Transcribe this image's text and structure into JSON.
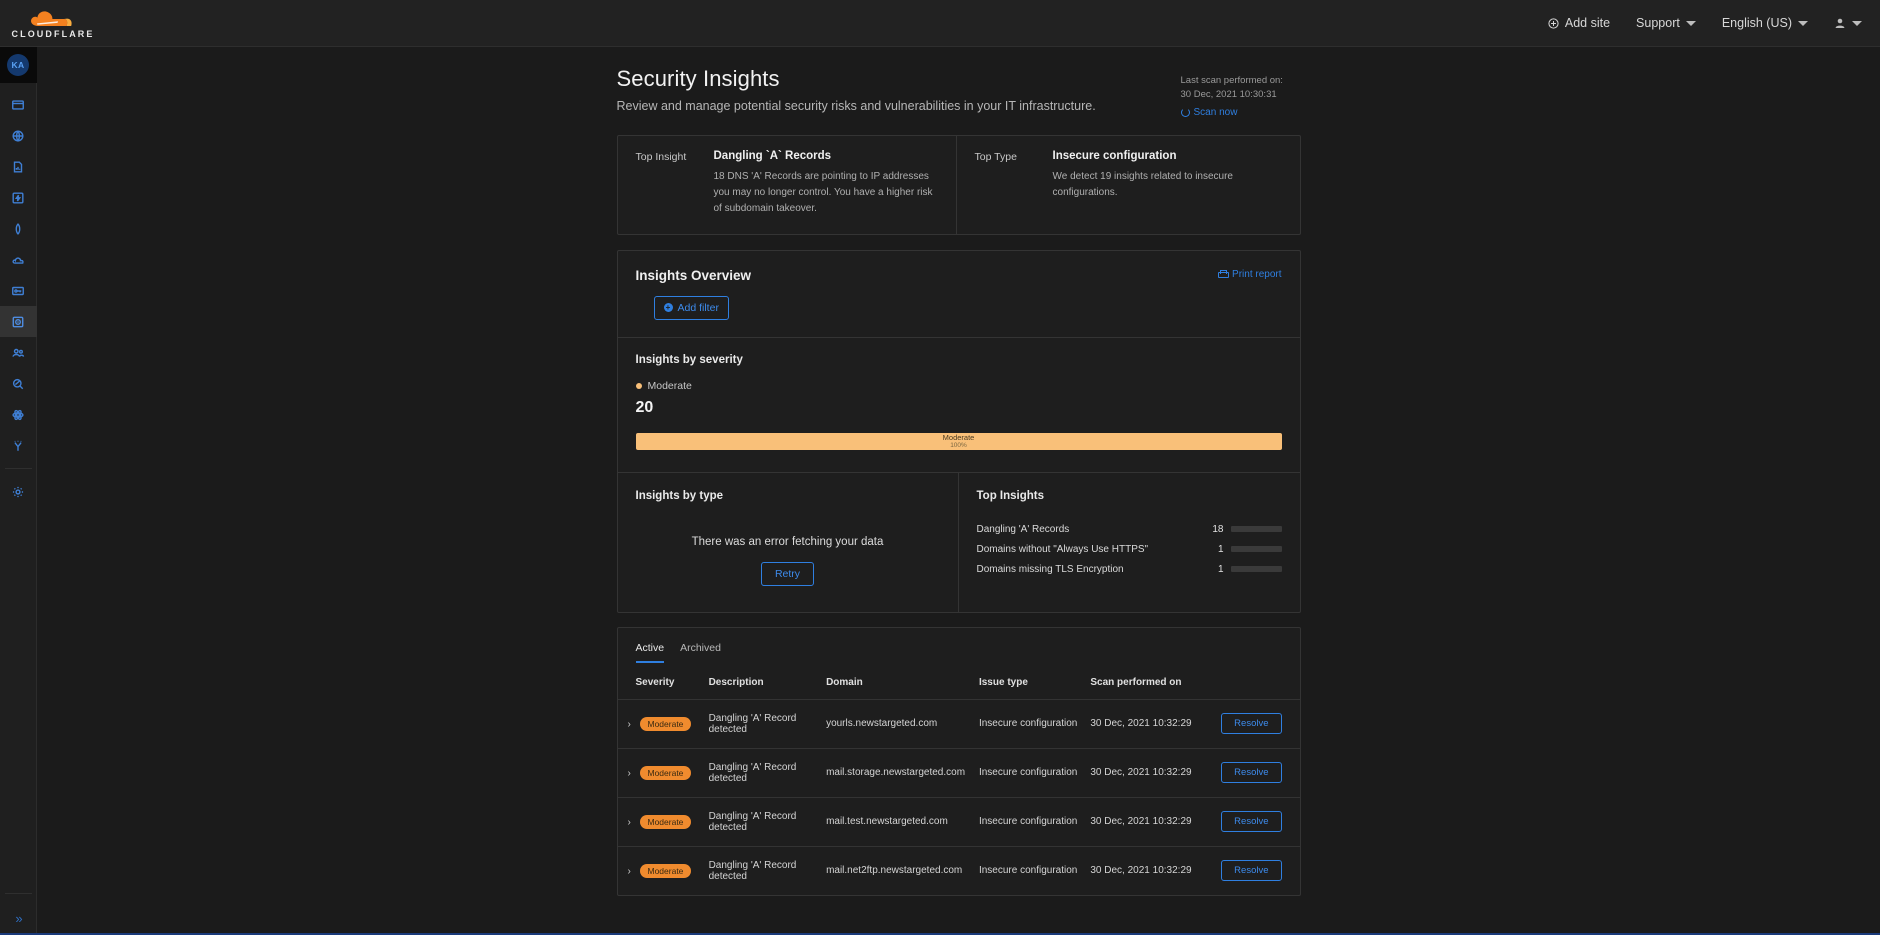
{
  "topbar": {
    "brand": "CLOUDFLARE",
    "add_site": "Add site",
    "support": "Support",
    "language": "English (US)"
  },
  "sidebar": {
    "avatar_initials": "KA",
    "expand_icon": "chevrons-right-icon",
    "items": [
      {
        "name": "sidebar-item-websites",
        "icon": "browser-window-icon"
      },
      {
        "name": "sidebar-item-dns",
        "icon": "globe-icon"
      },
      {
        "name": "sidebar-item-analytics",
        "icon": "document-chart-icon"
      },
      {
        "name": "sidebar-item-workers",
        "icon": "lightning-box-icon"
      },
      {
        "name": "sidebar-item-stream",
        "icon": "diamond-icon"
      },
      {
        "name": "sidebar-item-cloud",
        "icon": "cloud-icon"
      },
      {
        "name": "sidebar-item-access",
        "icon": "key-card-icon"
      },
      {
        "name": "sidebar-item-security-center",
        "icon": "shield-scan-icon"
      },
      {
        "name": "sidebar-item-teams",
        "icon": "users-icon"
      },
      {
        "name": "sidebar-item-radar",
        "icon": "magnifier-icon"
      },
      {
        "name": "sidebar-item-network",
        "icon": "atom-icon"
      },
      {
        "name": "sidebar-item-trace",
        "icon": "trace-icon"
      },
      {
        "name": "sidebar-item-settings",
        "icon": "gear-icon"
      }
    ]
  },
  "page": {
    "title": "Security Insights",
    "subtitle": "Review and manage potential security risks and vulnerabilities in your IT infrastructure.",
    "last_scan_label": "Last scan performed on:",
    "last_scan_value": "30 Dec, 2021 10:30:31",
    "scan_now": "Scan now"
  },
  "top_cards": {
    "insight_label": "Top Insight",
    "insight_title": "Dangling `A` Records",
    "insight_desc": "18 DNS 'A' Records are pointing to IP addresses you may no longer control. You have a higher risk of subdomain takeover.",
    "type_label": "Top Type",
    "type_title": "Insecure configuration",
    "type_desc": "We detect 19 insights related to insecure configurations."
  },
  "overview": {
    "title": "Insights Overview",
    "print_report": "Print report",
    "add_filter": "Add filter",
    "severity_title": "Insights by severity",
    "severity_legend": "Moderate",
    "severity_count": "20",
    "severity_bar_label": "Moderate",
    "severity_bar_pct": "100%",
    "severity_color": "#f9c079",
    "by_type_title": "Insights by type",
    "error_text": "There was an error fetching your data",
    "retry": "Retry",
    "top_insights_title": "Top Insights"
  },
  "chart_data": {
    "type": "bar",
    "title": "Top Insights",
    "orientation": "horizontal",
    "categories": [
      "Dangling 'A' Records",
      "Domains without \"Always Use HTTPS\"",
      "Domains missing TLS Encryption"
    ],
    "values": [
      18,
      1,
      1
    ],
    "max": 20,
    "bar_color": "#0a6ad8",
    "track_color": "#3a3a3a",
    "xlabel": "",
    "ylabel": "",
    "grid": false,
    "legend": "none"
  },
  "severity_chart": {
    "type": "bar",
    "title": "Insights by severity",
    "orientation": "stacked-horizontal",
    "categories": [
      "Moderate"
    ],
    "values": [
      100
    ],
    "counts": [
      20
    ],
    "unit": "%",
    "colors": [
      "#f9c079"
    ]
  },
  "table": {
    "tabs": [
      {
        "label": "Active",
        "active": true
      },
      {
        "label": "Archived",
        "active": false
      }
    ],
    "columns": [
      "Severity",
      "Description",
      "Domain",
      "Issue type",
      "Scan performed on"
    ],
    "action_label": "Resolve",
    "rows": [
      {
        "severity": "Moderate",
        "description": "Dangling 'A' Record detected",
        "domain": "yourls.newstargeted.com",
        "issue_type": "Insecure configuration",
        "scan": "30 Dec, 2021 10:32:29"
      },
      {
        "severity": "Moderate",
        "description": "Dangling 'A' Record detected",
        "domain": "mail.storage.newstargeted.com",
        "issue_type": "Insecure configuration",
        "scan": "30 Dec, 2021 10:32:29"
      },
      {
        "severity": "Moderate",
        "description": "Dangling 'A' Record detected",
        "domain": "mail.test.newstargeted.com",
        "issue_type": "Insecure configuration",
        "scan": "30 Dec, 2021 10:32:29"
      },
      {
        "severity": "Moderate",
        "description": "Dangling 'A' Record detected",
        "domain": "mail.net2ftp.newstargeted.com",
        "issue_type": "Insecure configuration",
        "scan": "30 Dec, 2021 10:32:29"
      }
    ]
  }
}
